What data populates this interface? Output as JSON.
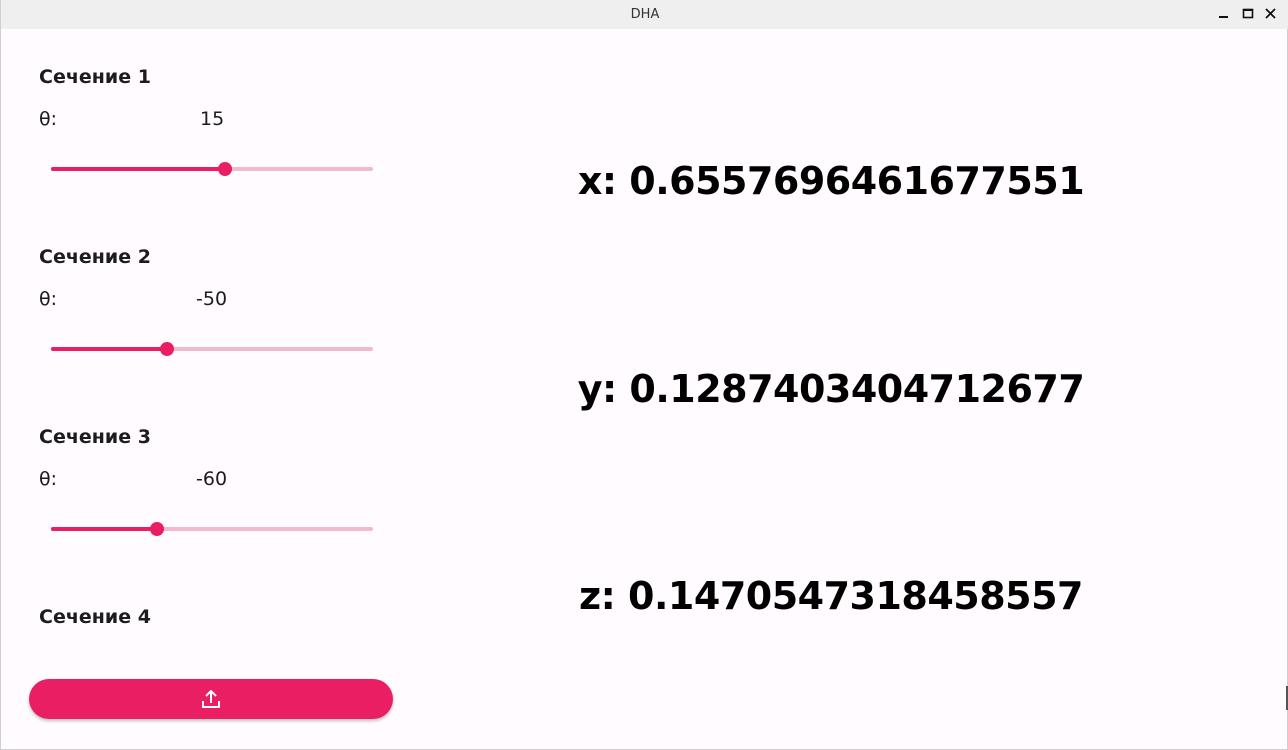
{
  "window": {
    "title": "DHA",
    "controls": [
      "minimize-icon",
      "maximize-icon",
      "close-icon"
    ]
  },
  "sections": [
    {
      "title": "Сечение 1",
      "theta_label": "θ:",
      "theta_value": "15",
      "slider_fraction": 0.54
    },
    {
      "title": "Сечение 2",
      "theta_label": "θ:",
      "theta_value": "-50",
      "slider_fraction": 0.36
    },
    {
      "title": "Сечение 3",
      "theta_label": "θ:",
      "theta_value": "-60",
      "slider_fraction": 0.33
    },
    {
      "title": "Сечение 4"
    }
  ],
  "results": {
    "x": "x: 0.6557696461677551",
    "y": "y: 0.1287403404712677",
    "z": "z: 0.1470547318458557"
  },
  "upload_button": {
    "icon": "upload-icon"
  },
  "colors": {
    "accent": "#e91e63",
    "track_inactive": "#f2b8cc",
    "background": "#fffbfe"
  }
}
